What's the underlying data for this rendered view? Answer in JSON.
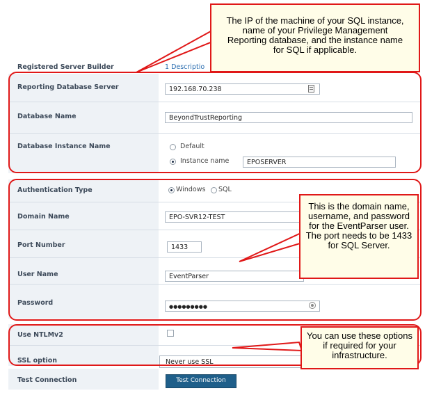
{
  "header": {
    "title": "Registered Server Builder",
    "description_link": "1 Descriptio"
  },
  "fields": {
    "server": {
      "label": "Reporting Database Server",
      "value": "192.168.70.238"
    },
    "dbname": {
      "label": "Database Name",
      "value": "BeyondTrustReporting"
    },
    "instance": {
      "label": "Database Instance Name",
      "option_default": "Default",
      "option_instance": "Instance name",
      "instance_value": "EPOSERVER",
      "selected": "Instance name"
    },
    "auth": {
      "label": "Authentication Type",
      "option_windows": "Windows",
      "option_sql": "SQL",
      "selected": "Windows"
    },
    "domain": {
      "label": "Domain Name",
      "value": "EPO-SVR12-TEST"
    },
    "port": {
      "label": "Port Number",
      "value": "1433"
    },
    "user": {
      "label": "User Name",
      "value": "EventParser"
    },
    "password": {
      "label": "Password",
      "value": "●●●●●●●●●"
    },
    "ntlm": {
      "label": "Use NTLMv2",
      "checked": false
    },
    "ssl": {
      "label": "SSL option",
      "value": "Never use SSL"
    },
    "test": {
      "label": "Test Connection",
      "button": "Test Connection"
    }
  },
  "callouts": {
    "top": "The IP of the machine of your SQL instance, name of your Privilege Management Reporting database, and the instance name for SQL if applicable.",
    "middle": "This is the domain name, username, and password for the EventParser user. The port needs to be 1433 for SQL Server.",
    "bottom": "You can use these options if required for your infrastructure."
  },
  "colors": {
    "annotation_red": "#e01818",
    "callout_bg": "#fffde8",
    "button_blue": "#1f5f8a",
    "label_text": "#3d4a5a"
  }
}
